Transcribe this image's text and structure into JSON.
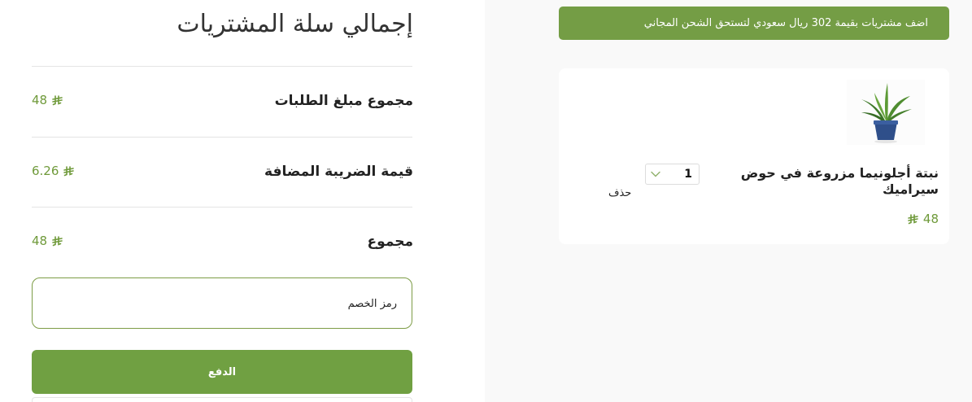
{
  "summary": {
    "title": "إجمالي سلة المشتريات",
    "rows": [
      {
        "label": "مجموع مبلغ الطلبات",
        "value": "48"
      },
      {
        "label": "قيمة الضريبة المضافة",
        "value": "6.26"
      },
      {
        "label": "مجموع",
        "value": "48"
      }
    ],
    "currency_symbol": "⃁",
    "coupon_placeholder": "رمز الخصم",
    "pay_label": "الدفع"
  },
  "cart": {
    "shipping_banner": "اضف مشتريات بقيمة 302 ريال سعودي لتستحق الشحن المجاني",
    "items": [
      {
        "name": "نبتة أجلونيما مزروعة في حوض سيراميك",
        "price": "48",
        "quantity": "1",
        "delete_label": "حذف",
        "image_icon": "potted-plant-image"
      }
    ]
  },
  "colors": {
    "accent": "#70a042",
    "banner": "#749d45",
    "price": "#6f9a3a",
    "panel_bg": "#f9f9f9"
  }
}
